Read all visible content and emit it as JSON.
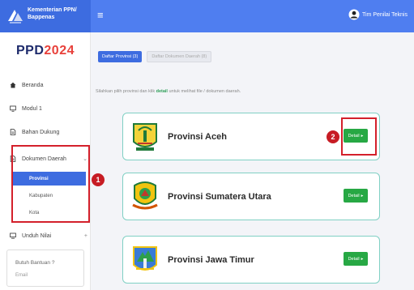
{
  "header": {
    "brand_text": "Kementerian PPN/ Bappenas",
    "menu_icon": "hamburger-icon",
    "user_name": "Tim Penilai Teknis",
    "user_icon": "user-circle-icon",
    "bar_color": "#4f7ef0"
  },
  "sidebar": {
    "logo_part1": "PPD",
    "logo_part2": "2024",
    "items": [
      {
        "label": "Beranda",
        "icon": "home-icon"
      },
      {
        "label": "Modul 1",
        "icon": "monitor-icon"
      },
      {
        "label": "Bahan Dukung",
        "icon": "document-icon"
      },
      {
        "label": "Dokumen Daerah",
        "icon": "document-icon",
        "chevron": "⌄"
      },
      {
        "label": "Unduh Nilai",
        "icon": "download-icon",
        "chevron": "+"
      }
    ],
    "subitems": [
      {
        "label": "Provinsi",
        "active": true
      },
      {
        "label": "Kabupaten",
        "active": false
      },
      {
        "label": "Kota",
        "active": false
      }
    ],
    "help": {
      "title": "Butuh Bantuan ?",
      "subtitle": "Email"
    }
  },
  "main": {
    "tabs": [
      {
        "label": "Daftar Provinsi (3)",
        "active": true
      },
      {
        "label": "Daftar Dokumen Daerah (8)",
        "active": false
      }
    ],
    "instruction_before": "Silahkan pilih provinsi dan klik ",
    "instruction_bold": "detail",
    "instruction_after": " untuk melihat file / dokumen daerah.",
    "provinces": [
      {
        "name": "Provinsi Aceh",
        "button": "Detail",
        "emblem": "aceh-emblem-icon"
      },
      {
        "name": "Provinsi Sumatera Utara",
        "button": "Detail",
        "emblem": "sumut-emblem-icon"
      },
      {
        "name": "Provinsi Jawa Timur",
        "button": "Detail",
        "emblem": "jatim-emblem-icon"
      }
    ]
  },
  "annotations": [
    {
      "number": "1",
      "color": "#d4202b"
    },
    {
      "number": "2",
      "color": "#d4202b"
    }
  ]
}
